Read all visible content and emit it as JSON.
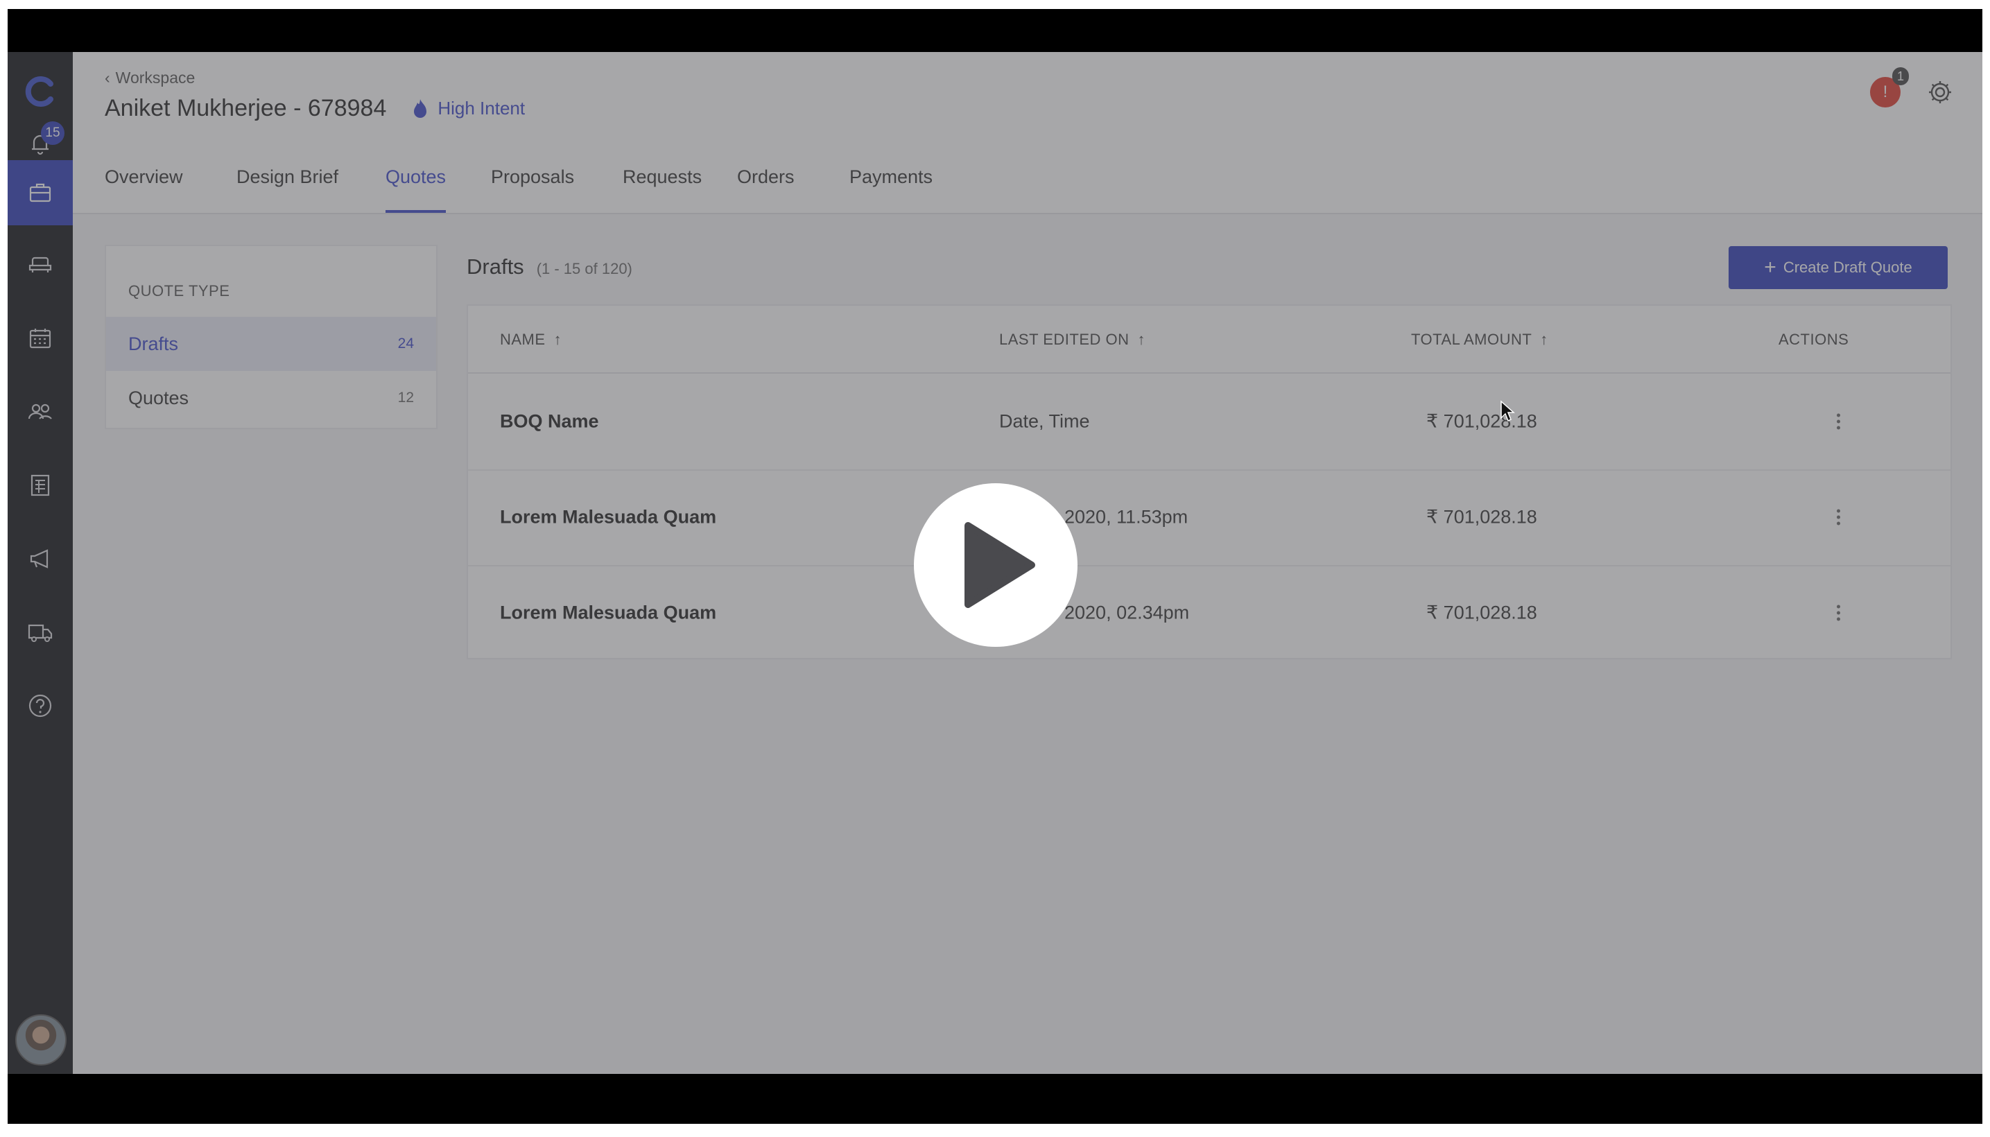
{
  "sidebar": {
    "notifications_badge": "15",
    "icons": [
      "logo-icon",
      "bell-icon",
      "briefcase-icon",
      "sofa-icon",
      "calendar-icon",
      "users-icon",
      "report-icon",
      "megaphone-icon",
      "truck-icon",
      "help-icon"
    ]
  },
  "header": {
    "breadcrumb": "Workspace",
    "title": "Aniket Mukherjee - 678984",
    "intent_label": "High Intent",
    "alert_count": "1"
  },
  "tabs": [
    {
      "label": "Overview"
    },
    {
      "label": "Design Brief"
    },
    {
      "label": "Quotes",
      "active": true
    },
    {
      "label": "Proposals"
    },
    {
      "label": "Requests"
    },
    {
      "label": "Orders"
    },
    {
      "label": "Payments"
    }
  ],
  "quote_type": {
    "heading": "QUOTE TYPE",
    "items": [
      {
        "label": "Drafts",
        "count": "24",
        "active": true
      },
      {
        "label": "Quotes",
        "count": "12"
      }
    ]
  },
  "drafts": {
    "title": "Drafts",
    "range": "(1 - 15 of 120)",
    "create_button": "Create Draft Quote",
    "columns": {
      "name": "NAME",
      "last_edited": "LAST EDITED ON",
      "total": "TOTAL AMOUNT",
      "actions": "ACTIONS"
    },
    "rows": [
      {
        "name": "BOQ Name",
        "edited": "Date, Time",
        "amount": "₹ 701,028.18"
      },
      {
        "name": "Lorem Malesuada Quam",
        "edited": "2020, 11.53pm",
        "amount": "₹ 701,028.18"
      },
      {
        "name": "Lorem Malesuada Quam",
        "edited": "2020, 02.34pm",
        "amount": "₹ 701,028.18"
      }
    ]
  },
  "colors": {
    "accent": "#2e3cb8",
    "sidebar": "#121418",
    "alert": "#e03a2f"
  },
  "overlay": {
    "icon": "play-icon"
  }
}
